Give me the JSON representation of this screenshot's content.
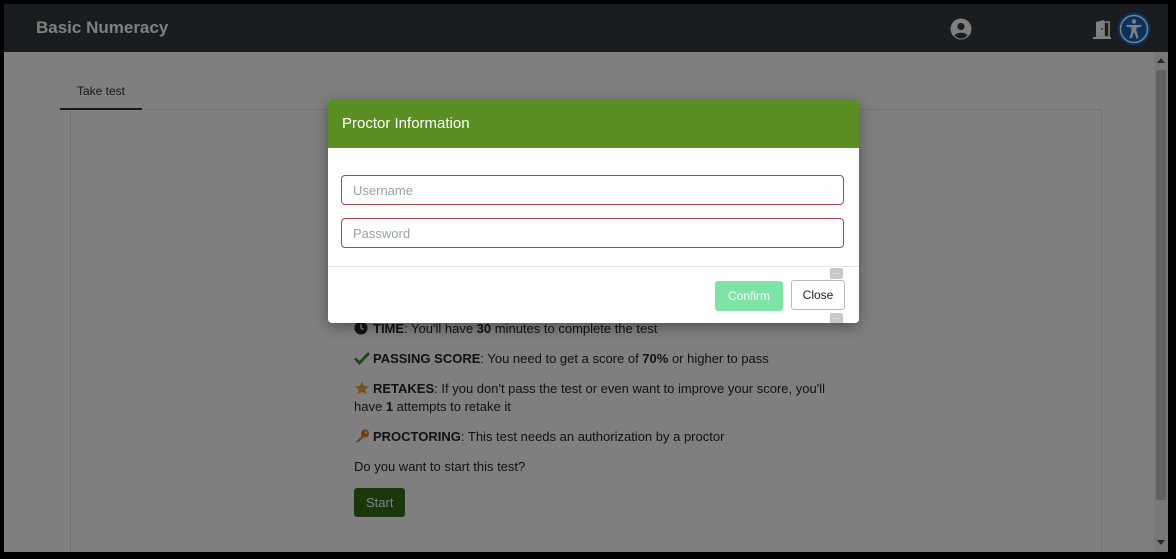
{
  "app": {
    "title": "Basic Numeracy"
  },
  "icons": {
    "user": "user-circle-icon",
    "exit": "door-exit-icon",
    "accessibility": "accessibility-icon"
  },
  "tabs": [
    {
      "label": "Take test"
    }
  ],
  "info": {
    "time_label": "TIME",
    "time_text_before": ": You'll have ",
    "time_value": "30",
    "time_text_after": " minutes to complete the test",
    "passing_label": "PASSING SCORE",
    "passing_text_before": ": You need to get a score of ",
    "passing_value": "70%",
    "passing_text_after": " or higher to pass",
    "retakes_label": "RETAKES",
    "retakes_text_before": ": If you don't pass the test or even want to improve your score, you'll have ",
    "retakes_value": "1",
    "retakes_text_after": " attempts to retake it",
    "proctoring_label": "PROCTORING",
    "proctoring_text": ": This test needs an authorization by a proctor",
    "question": "Do you want to start this test?",
    "start_label": "Start"
  },
  "modal": {
    "title": "Proctor Information",
    "username_placeholder": "Username",
    "username_value": "",
    "password_placeholder": "Password",
    "password_value": "",
    "confirm_label": "Confirm",
    "close_label": "Close"
  },
  "colors": {
    "topbar": "#343a40",
    "modal_header": "#5a8e23",
    "confirm": "#7de3a6",
    "start": "#3a6e1a",
    "field_border": "#b3434a",
    "check": "#3a8a2a",
    "star": "#e8a33d",
    "key": "#e07a22"
  }
}
